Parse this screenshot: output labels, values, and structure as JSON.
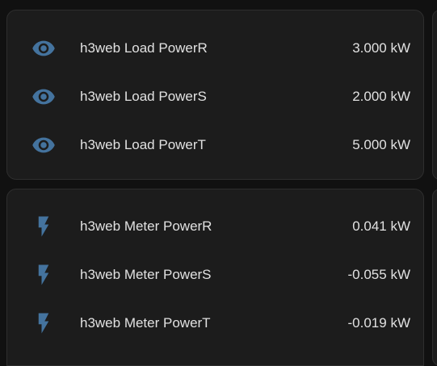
{
  "colors": {
    "icon": "#44739e",
    "text": "#e1e1e1",
    "card": "#1c1c1c",
    "background": "#111111"
  },
  "load_card": {
    "entities": [
      {
        "icon": "eye-icon",
        "name": "h3web Load PowerR",
        "value": "3.000 kW"
      },
      {
        "icon": "eye-icon",
        "name": "h3web Load PowerS",
        "value": "2.000 kW"
      },
      {
        "icon": "eye-icon",
        "name": "h3web Load PowerT",
        "value": "5.000 kW"
      }
    ]
  },
  "meter_card": {
    "entities": [
      {
        "icon": "flash-icon",
        "name": "h3web Meter PowerR",
        "value": "0.041 kW"
      },
      {
        "icon": "flash-icon",
        "name": "h3web Meter PowerS",
        "value": "-0.055 kW"
      },
      {
        "icon": "flash-icon",
        "name": "h3web Meter PowerT",
        "value": "-0.019 kW"
      }
    ]
  }
}
